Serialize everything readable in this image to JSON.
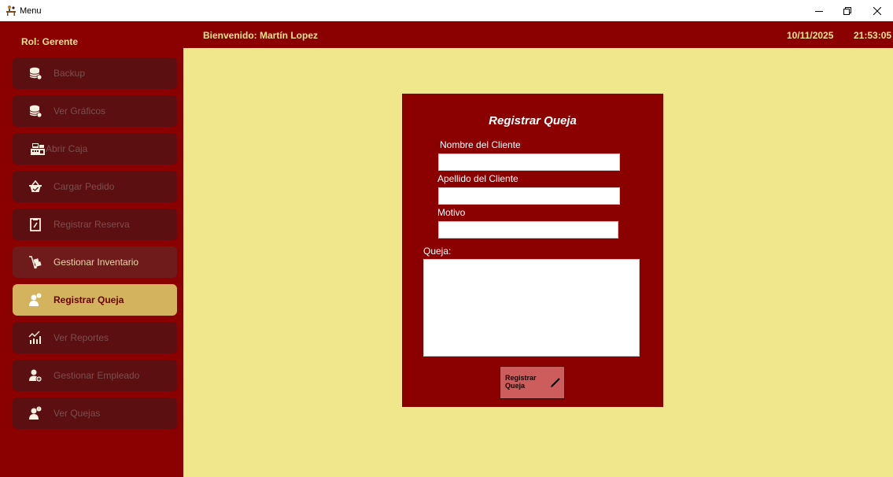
{
  "window": {
    "title": "Menu",
    "controls": [
      "minimize-icon",
      "restore-icon",
      "close-icon"
    ]
  },
  "header": {
    "welcome": "Bienvenido: Martín Lopez",
    "date": "10/11/2025",
    "time": "21:53:05"
  },
  "sidebar": {
    "role": "Rol: Gerente",
    "items": [
      {
        "label": "Backup",
        "icon": "database-icon"
      },
      {
        "label": "Ver Gráficos",
        "icon": "database-icon"
      },
      {
        "label": "Abrir Caja",
        "icon": "cash-register-icon"
      },
      {
        "label": "Cargar Pedido",
        "icon": "basket-icon"
      },
      {
        "label": "Registrar Reserva",
        "icon": "clipboard-icon"
      },
      {
        "label": "Gestionar Inventario",
        "icon": "hand-truck-icon"
      },
      {
        "label": "Registrar Queja",
        "icon": "user-complaint-icon"
      },
      {
        "label": "Ver Reportes",
        "icon": "chart-trend-icon"
      },
      {
        "label": "Gestionar Empleado",
        "icon": "add-user-icon"
      },
      {
        "label": "Ver Quejas",
        "icon": "user-complaint-icon"
      }
    ],
    "active_index": 6
  },
  "form": {
    "title": "Registrar Queja",
    "nombre_label": "Nombre del Cliente",
    "nombre_value": "",
    "apellido_label": "Apellido del Cliente",
    "apellido_value": "",
    "motivo_label": "Motivo",
    "motivo_value": "",
    "queja_label": "Queja:",
    "queja_value": "",
    "submit_label": "Registrar Queja",
    "submit_icon": "pencil-icon"
  },
  "colors": {
    "primary": "#8b0000",
    "background": "#f0e68c",
    "accent_text": "#f0e68c",
    "active_item": "#d4b35e",
    "button": "#cd5c5c"
  }
}
